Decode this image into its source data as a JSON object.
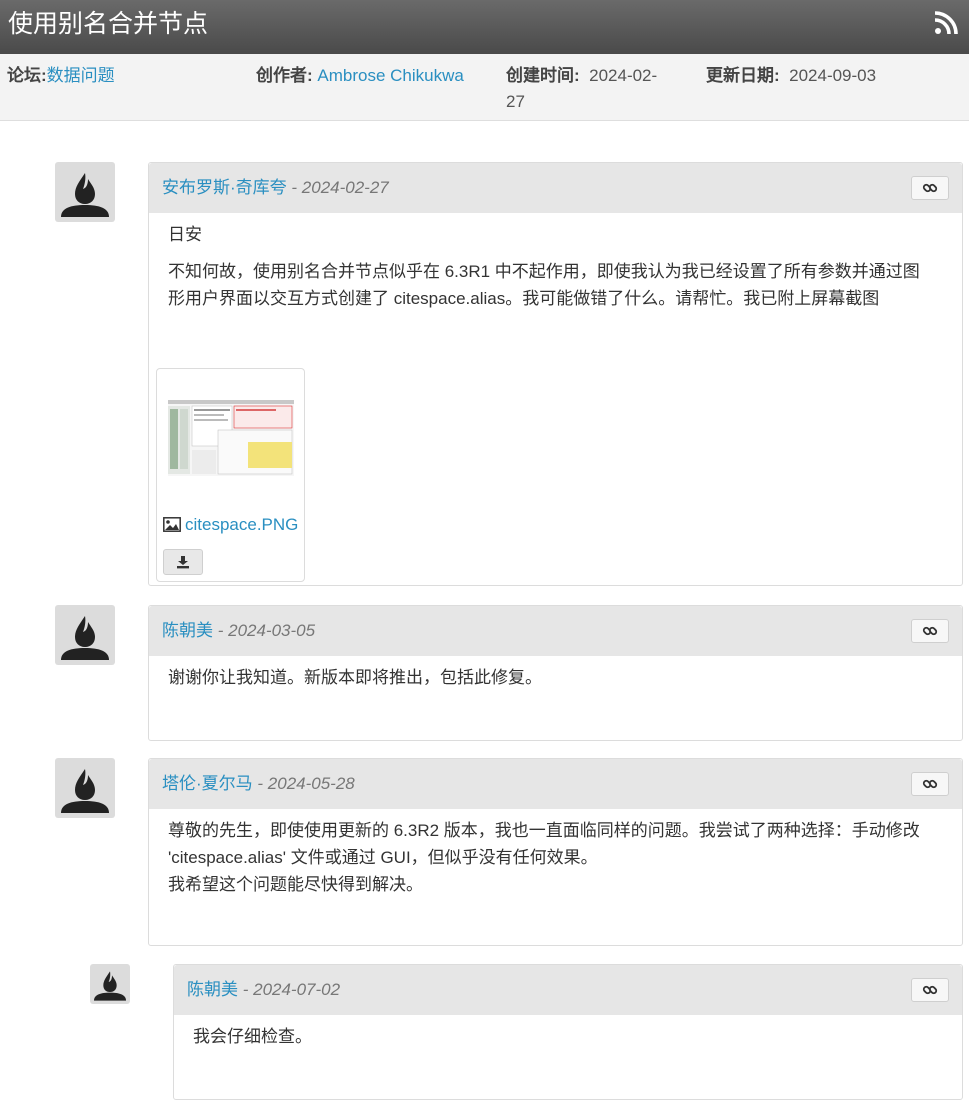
{
  "topic": {
    "title": "使用别名合并节点",
    "rss_icon": "rss-icon"
  },
  "meta": {
    "forum_label": "论坛:",
    "forum_value": "数据问题",
    "author_label": "创作者:",
    "author_value": "Ambrose Chikukwa",
    "created_label": "创建时间:",
    "created_line1": "2024-02-",
    "created_line2": "27",
    "updated_label": "更新日期:",
    "updated_value": "2024-09-03"
  },
  "posts": [
    {
      "author": "安布罗斯·奇库夸",
      "date": "- 2024-02-27",
      "body": [
        "日安",
        "不知何故，使用别名合并节点似乎在 6.3R1 中不起作用，即使我认为我已经设置了所有参数并通过图形用户界面以交互方式创建了 citespace.alias。我可能做错了什么。请帮忙。我已附上屏幕截图"
      ],
      "attachment": {
        "file_name": "citespace.PNG"
      }
    },
    {
      "author": "陈朝美",
      "date": "- 2024-03-05",
      "body": [
        "谢谢你让我知道。新版本即将推出，包括此修复。"
      ]
    },
    {
      "author": "塔伦·夏尔马",
      "date": "- 2024-05-28",
      "body": [
        "尊敬的先生，即使使用更新的 6.3R2 版本，我也一直面临同样的问题。我尝试了两种选择：手动修改 'citespace.alias' 文件或通过 GUI，但似乎没有任何效果。",
        "我希望这个问题能尽快得到解决。"
      ]
    },
    {
      "author": "陈朝美",
      "date": "- 2024-07-02",
      "body": [
        "我会仔细检查。"
      ]
    }
  ],
  "colors": {
    "link": "#2a8fc1",
    "header_bg": "#555555",
    "post_head_bg": "#e6e6e6"
  }
}
